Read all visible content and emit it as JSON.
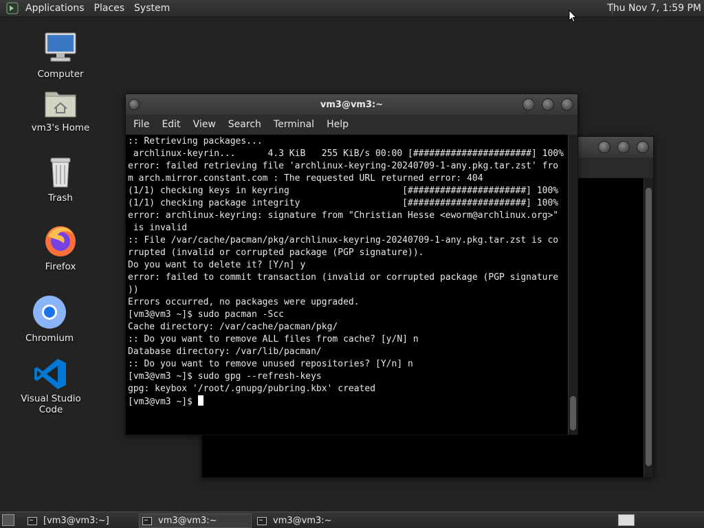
{
  "top_panel": {
    "menus": [
      "Applications",
      "Places",
      "System"
    ],
    "clock": "Thu Nov  7,  1:59 PM"
  },
  "desktop_icons": [
    {
      "label": "Computer",
      "icon": "computer-icon"
    },
    {
      "label": "vm3's Home",
      "icon": "home-folder-icon"
    },
    {
      "label": "Trash",
      "icon": "trash-icon"
    },
    {
      "label": "Firefox",
      "icon": "firefox-icon"
    },
    {
      "label": "Chromium",
      "icon": "chromium-icon"
    },
    {
      "label": "Visual Studio Code",
      "icon": "vscode-icon"
    }
  ],
  "terminal": {
    "title": "vm3@vm3:~",
    "menu": [
      "File",
      "Edit",
      "View",
      "Search",
      "Terminal",
      "Help"
    ],
    "lines": [
      ":: Retrieving packages...",
      " archlinux-keyrin...      4.3 KiB   255 KiB/s 00:00 [######################] 100%",
      "error: failed retrieving file 'archlinux-keyring-20240709-1-any.pkg.tar.zst' fro",
      "m arch.mirror.constant.com : The requested URL returned error: 404",
      "(1/1) checking keys in keyring                     [######################] 100%",
      "(1/1) checking package integrity                   [######################] 100%",
      "error: archlinux-keyring: signature from \"Christian Hesse <eworm@archlinux.org>\"",
      " is invalid",
      ":: File /var/cache/pacman/pkg/archlinux-keyring-20240709-1-any.pkg.tar.zst is co",
      "rrupted (invalid or corrupted package (PGP signature)).",
      "Do you want to delete it? [Y/n] y",
      "error: failed to commit transaction (invalid or corrupted package (PGP signature",
      "))",
      "Errors occurred, no packages were upgraded.",
      "[vm3@vm3 ~]$ sudo pacman -Scc",
      "",
      "Cache directory: /var/cache/pacman/pkg/",
      ":: Do you want to remove ALL files from cache? [y/N] n",
      "",
      "Database directory: /var/lib/pacman/",
      ":: Do you want to remove unused repositories? [Y/n] n",
      "[vm3@vm3 ~]$ sudo gpg --refresh-keys",
      "gpg: keybox '/root/.gnupg/pubring.kbx' created",
      "[vm3@vm3 ~]$ "
    ]
  },
  "taskbar": {
    "items": [
      "[vm3@vm3:~]",
      "vm3@vm3:~",
      "vm3@vm3:~"
    ]
  }
}
